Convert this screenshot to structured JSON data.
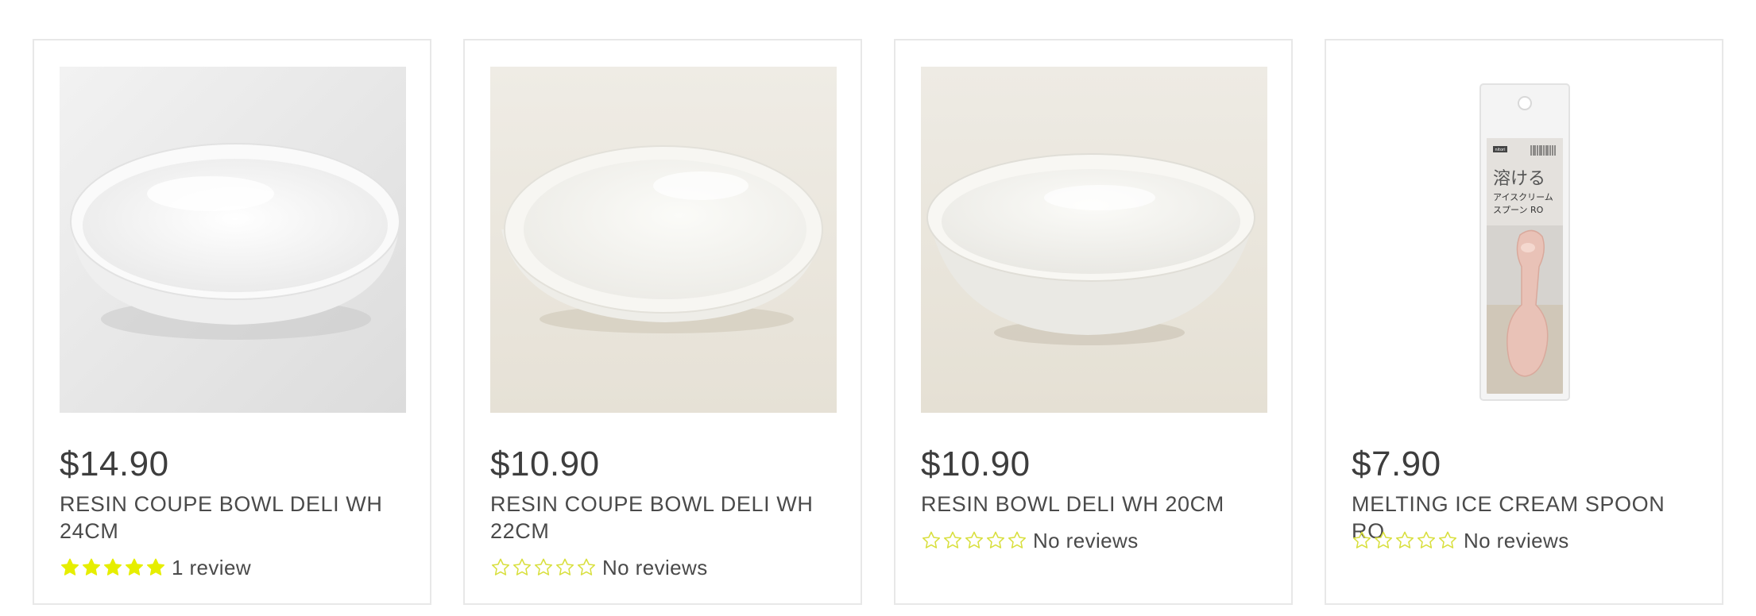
{
  "colors": {
    "star_fill": "#e6ee00",
    "star_outline": "#d8df3c",
    "border": "#e8e8e8",
    "text": "#404040"
  },
  "products": [
    {
      "price": "$14.90",
      "title": "RESIN COUPE BOWL DELI WH 24CM",
      "rating_value": 5,
      "rating_max": 5,
      "review_text": "1 review",
      "image": "white-coupe-bowl-24cm"
    },
    {
      "price": "$10.90",
      "title": "RESIN COUPE BOWL DELI WH 22CM",
      "rating_value": 0,
      "rating_max": 5,
      "review_text": "No reviews",
      "image": "white-coupe-bowl-22cm"
    },
    {
      "price": "$10.90",
      "title": "RESIN BOWL DELI WH 20CM",
      "rating_value": 0,
      "rating_max": 5,
      "review_text": "No reviews",
      "image": "white-deli-bowl-20cm"
    },
    {
      "price": "$7.90",
      "title": "MELTING ICE CREAM SPOON RO",
      "rating_value": 0,
      "rating_max": 5,
      "review_text": "No reviews",
      "image": "pink-ice-cream-spoon-package",
      "package_text": {
        "brand": "nitori",
        "heading": "溶ける",
        "line1": "アイスクリーム",
        "line2": "スプーン RO"
      }
    }
  ]
}
